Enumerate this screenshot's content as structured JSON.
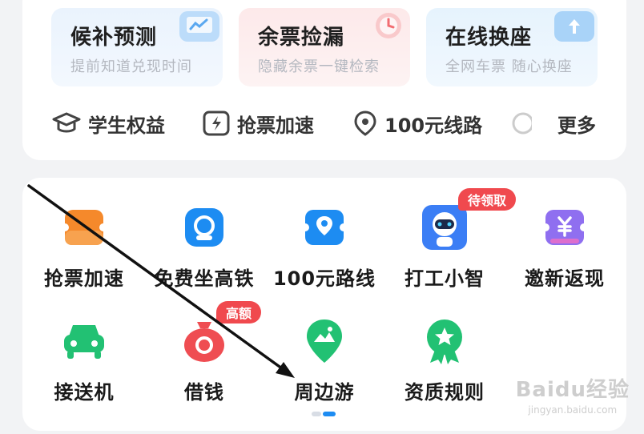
{
  "features": [
    {
      "title": "候补预测",
      "subtitle": "提前知道兑现时间",
      "icon": "chart-monitor-icon",
      "color": "#5aa8f0"
    },
    {
      "title": "余票捡漏",
      "subtitle": "隐藏余票一键检索",
      "icon": "clock-icon",
      "color": "#f26d72"
    },
    {
      "title": "在线换座",
      "subtitle": "全网车票 随心换座",
      "icon": "swap-seat-icon",
      "color": "#5aa8f0"
    }
  ],
  "quick_links": [
    {
      "label": "学生权益",
      "icon": "graduation-cap-icon"
    },
    {
      "label": "抢票加速",
      "icon": "lightning-ticket-icon"
    },
    {
      "label": "100元线路",
      "icon": "location-pin-icon"
    },
    {
      "label": "更多",
      "icon": "more-icon"
    }
  ],
  "grid": {
    "row1": [
      {
        "label": "抢票加速",
        "icon": "ticket-boost-icon",
        "color": "#f5892b"
      },
      {
        "label": "免费坐高铁",
        "icon": "train-icon",
        "color": "#1d8cf2"
      },
      {
        "label": "100元路线",
        "icon": "route-pin-icon",
        "color": "#1d8cf2"
      },
      {
        "label": "打工小智",
        "icon": "robot-assistant-icon",
        "color": "#3b7ef5",
        "badge": "待领取"
      },
      {
        "label": "邀新返现",
        "icon": "cashback-icon",
        "color": "#8f6ff0"
      }
    ],
    "row2": [
      {
        "label": "接送机",
        "icon": "car-icon",
        "color": "#22c173"
      },
      {
        "label": "借钱",
        "icon": "money-bag-icon",
        "color": "#ef4d52",
        "badge": "高额"
      },
      {
        "label": "周边游",
        "icon": "map-pin-landscape-icon",
        "color": "#22c173"
      },
      {
        "label": "资质规则",
        "icon": "qualification-badge-icon",
        "color": "#22c173"
      }
    ]
  },
  "watermark": {
    "main": "Baidu经验",
    "sub": "jingyan.baidu.com"
  },
  "colors": {
    "accent": "#1d8cf2",
    "badge": "#f0494e"
  }
}
